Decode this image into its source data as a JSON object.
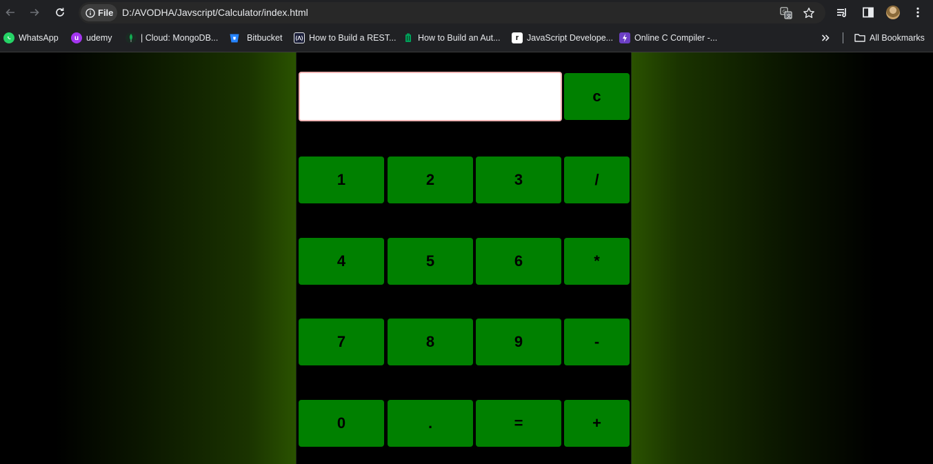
{
  "browser": {
    "scheme_label": "File",
    "url": "D:/AVODHA/Javscript/Calculator/index.html",
    "icons": {
      "back": "arrow-left-icon",
      "forward": "arrow-right-icon",
      "reload": "reload-icon",
      "info": "info-icon",
      "translate": "translate-icon",
      "bookmark_star": "star-icon",
      "reading_list": "reading-list-icon",
      "side_panel": "side-panel-icon",
      "profile": "avatar",
      "menu": "kebab-menu-icon"
    }
  },
  "bookmarks": {
    "items": [
      {
        "label": "WhatsApp",
        "icon": "whatsapp-icon",
        "color": "#25d366"
      },
      {
        "label": "udemy",
        "icon": "udemy-icon",
        "color": "#a435f0"
      },
      {
        "label": "| Cloud: MongoDB...",
        "icon": "mongodb-icon",
        "color": "#13aa52"
      },
      {
        "label": "Bitbucket",
        "icon": "bitbucket-icon",
        "color": "#2684ff"
      },
      {
        "label": "How to Build a REST...",
        "icon": "api-icon",
        "color": "#ffffff"
      },
      {
        "label": "How to Build an Aut...",
        "icon": "bin-icon",
        "color": "#00a05a"
      },
      {
        "label": "JavaScript Develope...",
        "icon": "r-icon",
        "color": "#ffffff"
      },
      {
        "label": "Online C Compiler -...",
        "icon": "bolt-icon",
        "color": "#6c3fc5"
      }
    ],
    "overflow_icon": "chevron-double-right-icon",
    "all_bookmarks_label": "All Bookmarks",
    "all_bookmarks_icon": "folder-icon"
  },
  "calculator": {
    "display_value": "",
    "clear_label": "c",
    "rows": [
      [
        "1",
        "2",
        "3",
        "/"
      ],
      [
        "4",
        "5",
        "6",
        "*"
      ],
      [
        "7",
        "8",
        "9",
        "-"
      ],
      [
        "0",
        ".",
        "=",
        "+"
      ]
    ],
    "colors": {
      "button": "#008000",
      "background": "#000000",
      "glow": "#2a5200"
    }
  }
}
